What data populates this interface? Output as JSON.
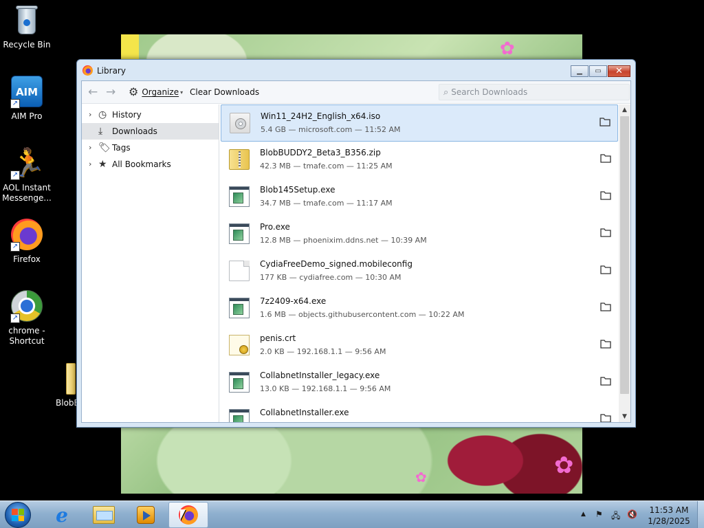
{
  "desktop": {
    "icons": [
      {
        "label": "Recycle Bin"
      },
      {
        "label": "AIM Pro",
        "glyph": "AIM"
      },
      {
        "label": "AOL Instant Messenge..."
      },
      {
        "label": "Firefox"
      },
      {
        "label": "chrome - Shortcut"
      }
    ],
    "partial_label": "BlobE"
  },
  "window": {
    "title": "Library",
    "controls": {
      "minimize": "minimize-icon",
      "maximize": "maximize-icon",
      "close": "close-icon"
    }
  },
  "toolbar": {
    "organize_label": "Organize",
    "clear_label": "Clear Downloads",
    "search_placeholder": "Search Downloads"
  },
  "sidebar": {
    "items": [
      {
        "label": "History",
        "icon": "clock-icon",
        "expandable": true,
        "selected": false
      },
      {
        "label": "Downloads",
        "icon": "download-icon",
        "expandable": false,
        "selected": true
      },
      {
        "label": "Tags",
        "icon": "tag-icon",
        "expandable": true,
        "selected": false
      },
      {
        "label": "All Bookmarks",
        "icon": "star-icon",
        "expandable": true,
        "selected": false
      }
    ]
  },
  "downloads": [
    {
      "name": "Win11_24H2_English_x64.iso",
      "meta": "5.4 GB — microsoft.com — 11:52 AM",
      "type": "disc",
      "selected": true
    },
    {
      "name": "BlobBUDDY2_Beta3_B356.zip",
      "meta": "42.3 MB — tmafe.com — 11:25 AM",
      "type": "zip"
    },
    {
      "name": "Blob145Setup.exe",
      "meta": "34.7 MB — tmafe.com — 11:17 AM",
      "type": "exe"
    },
    {
      "name": "Pro.exe",
      "meta": "12.8 MB — phoenixim.ddns.net — 10:39 AM",
      "type": "exe"
    },
    {
      "name": "CydiaFreeDemo_signed.mobileconfig",
      "meta": "177 KB — cydiafree.com — 10:30 AM",
      "type": "doc"
    },
    {
      "name": "7z2409-x64.exe",
      "meta": "1.6 MB — objects.githubusercontent.com — 10:22 AM",
      "type": "exe"
    },
    {
      "name": "penis.crt",
      "meta": "2.0 KB — 192.168.1.1 — 9:56 AM",
      "type": "cert"
    },
    {
      "name": "CollabnetInstaller_legacy.exe",
      "meta": "13.0 KB — 192.168.1.1 — 9:56 AM",
      "type": "exe"
    },
    {
      "name": "CollabnetInstaller.exe",
      "meta": "",
      "type": "exe"
    }
  ],
  "taskbar": {
    "clock_time": "11:53 AM",
    "clock_date": "1/28/2025",
    "pinned": [
      "internet-explorer-icon",
      "windows-explorer-icon",
      "media-player-icon",
      "firefox-icon"
    ]
  }
}
